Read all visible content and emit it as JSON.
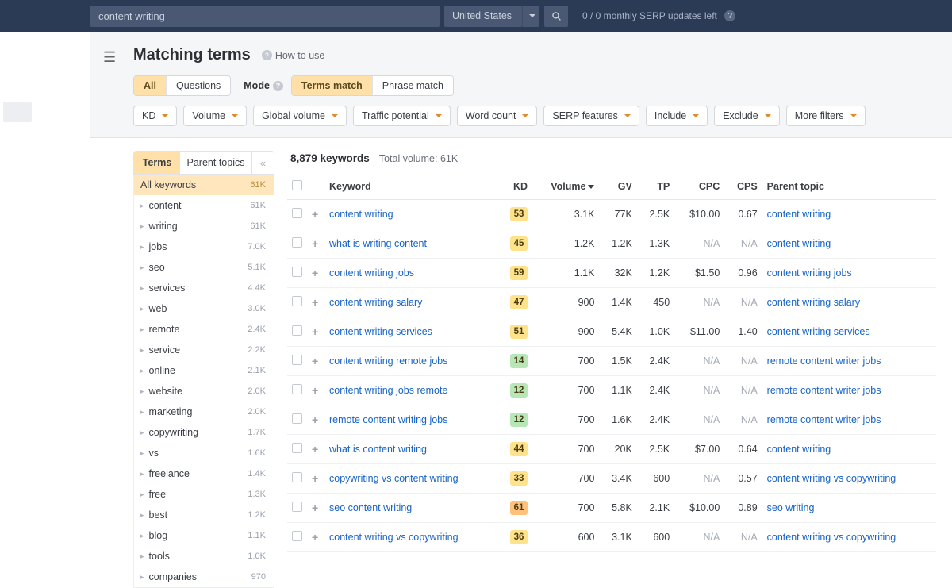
{
  "topbar": {
    "search_value": "content writing",
    "country": "United States",
    "serp_updates": "0 / 0 monthly SERP updates left"
  },
  "header": {
    "page_title": "Matching terms",
    "how_to_use": "How to use",
    "subtabs": {
      "all": "All",
      "questions": "Questions"
    },
    "mode_label": "Mode",
    "mode_tabs": {
      "terms_match": "Terms match",
      "phrase_match": "Phrase match"
    }
  },
  "filters": {
    "kd": "KD",
    "volume": "Volume",
    "global_volume": "Global volume",
    "traffic_potential": "Traffic potential",
    "word_count": "Word count",
    "serp_features": "SERP features",
    "include": "Include",
    "exclude": "Exclude",
    "more_filters": "More filters"
  },
  "sidebar": {
    "tabs": {
      "terms": "Terms",
      "parent_topics": "Parent topics"
    },
    "all_label": "All keywords",
    "all_count": "61K",
    "items": [
      {
        "label": "content",
        "count": "61K"
      },
      {
        "label": "writing",
        "count": "61K"
      },
      {
        "label": "jobs",
        "count": "7.0K"
      },
      {
        "label": "seo",
        "count": "5.1K"
      },
      {
        "label": "services",
        "count": "4.4K"
      },
      {
        "label": "web",
        "count": "3.0K"
      },
      {
        "label": "remote",
        "count": "2.4K"
      },
      {
        "label": "service",
        "count": "2.2K"
      },
      {
        "label": "online",
        "count": "2.1K"
      },
      {
        "label": "website",
        "count": "2.0K"
      },
      {
        "label": "marketing",
        "count": "2.0K"
      },
      {
        "label": "copywriting",
        "count": "1.7K"
      },
      {
        "label": "vs",
        "count": "1.6K"
      },
      {
        "label": "freelance",
        "count": "1.4K"
      },
      {
        "label": "free",
        "count": "1.3K"
      },
      {
        "label": "best",
        "count": "1.2K"
      },
      {
        "label": "blog",
        "count": "1.1K"
      },
      {
        "label": "tools",
        "count": "1.0K"
      },
      {
        "label": "companies",
        "count": "970"
      }
    ]
  },
  "main": {
    "kw_count": "8,879 keywords",
    "total_volume": "Total volume: 61K",
    "columns": {
      "keyword": "Keyword",
      "kd": "KD",
      "volume": "Volume",
      "gv": "GV",
      "tp": "TP",
      "cpc": "CPC",
      "cps": "CPS",
      "parent_topic": "Parent topic"
    },
    "rows": [
      {
        "kw": "content writing",
        "kd": "53",
        "kdc": "kd-y",
        "vol": "3.1K",
        "gv": "77K",
        "tp": "2.5K",
        "cpc": "$10.00",
        "cps": "0.67",
        "parent": "content writing"
      },
      {
        "kw": "what is writing content",
        "kd": "45",
        "kdc": "kd-y",
        "vol": "1.2K",
        "gv": "1.2K",
        "tp": "1.3K",
        "cpc": "N/A",
        "cps": "N/A",
        "parent": "content writing"
      },
      {
        "kw": "content writing jobs",
        "kd": "59",
        "kdc": "kd-y",
        "vol": "1.1K",
        "gv": "32K",
        "tp": "1.2K",
        "cpc": "$1.50",
        "cps": "0.96",
        "parent": "content writing jobs"
      },
      {
        "kw": "content writing salary",
        "kd": "47",
        "kdc": "kd-y",
        "vol": "900",
        "gv": "1.4K",
        "tp": "450",
        "cpc": "N/A",
        "cps": "N/A",
        "parent": "content writing salary"
      },
      {
        "kw": "content writing services",
        "kd": "51",
        "kdc": "kd-y",
        "vol": "900",
        "gv": "5.4K",
        "tp": "1.0K",
        "cpc": "$11.00",
        "cps": "1.40",
        "parent": "content writing services"
      },
      {
        "kw": "content writing remote jobs",
        "kd": "14",
        "kdc": "kd-g",
        "vol": "700",
        "gv": "1.5K",
        "tp": "2.4K",
        "cpc": "N/A",
        "cps": "N/A",
        "parent": "remote content writer jobs"
      },
      {
        "kw": "content writing jobs remote",
        "kd": "12",
        "kdc": "kd-g",
        "vol": "700",
        "gv": "1.1K",
        "tp": "2.4K",
        "cpc": "N/A",
        "cps": "N/A",
        "parent": "remote content writer jobs"
      },
      {
        "kw": "remote content writing jobs",
        "kd": "12",
        "kdc": "kd-g",
        "vol": "700",
        "gv": "1.6K",
        "tp": "2.4K",
        "cpc": "N/A",
        "cps": "N/A",
        "parent": "remote content writer jobs"
      },
      {
        "kw": "what is content writing",
        "kd": "44",
        "kdc": "kd-y",
        "vol": "700",
        "gv": "20K",
        "tp": "2.5K",
        "cpc": "$7.00",
        "cps": "0.64",
        "parent": "content writing"
      },
      {
        "kw": "copywriting vs content writing",
        "kd": "33",
        "kdc": "kd-y",
        "vol": "700",
        "gv": "3.4K",
        "tp": "600",
        "cpc": "N/A",
        "cps": "0.57",
        "parent": "content writing vs copywriting"
      },
      {
        "kw": "seo content writing",
        "kd": "61",
        "kdc": "kd-o",
        "vol": "700",
        "gv": "5.8K",
        "tp": "2.1K",
        "cpc": "$10.00",
        "cps": "0.89",
        "parent": "seo writing"
      },
      {
        "kw": "content writing vs copywriting",
        "kd": "36",
        "kdc": "kd-y",
        "vol": "600",
        "gv": "3.1K",
        "tp": "600",
        "cpc": "N/A",
        "cps": "N/A",
        "parent": "content writing vs copywriting"
      }
    ]
  }
}
